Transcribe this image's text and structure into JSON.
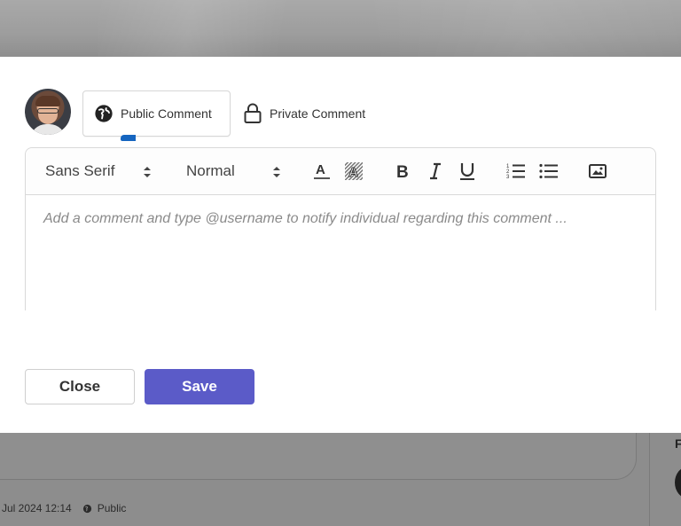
{
  "background": {
    "meta_date": "Jul 2024 12:14",
    "meta_visibility": "Public",
    "side_letter": "F"
  },
  "comment_modal": {
    "tabs": [
      {
        "label": "Public Comment",
        "icon": "globe-icon",
        "selected": true
      },
      {
        "label": "Private Comment",
        "icon": "lock-icon",
        "selected": false
      }
    ],
    "toolbar": {
      "font_family": "Sans Serif",
      "font_size": "Normal",
      "buttons": [
        "text-color-icon",
        "highlight-icon",
        "bold-icon",
        "italic-icon",
        "underline-icon",
        "ordered-list-icon",
        "bullet-list-icon",
        "image-icon"
      ]
    },
    "editor_placeholder": "Add a comment and type @username to notify individual regarding this comment ...",
    "actions": {
      "close_label": "Close",
      "save_label": "Save"
    }
  },
  "colors": {
    "accent": "#5b5bc8",
    "tab_indicator": "#1565c0",
    "overlay": "#8f8f8f"
  }
}
